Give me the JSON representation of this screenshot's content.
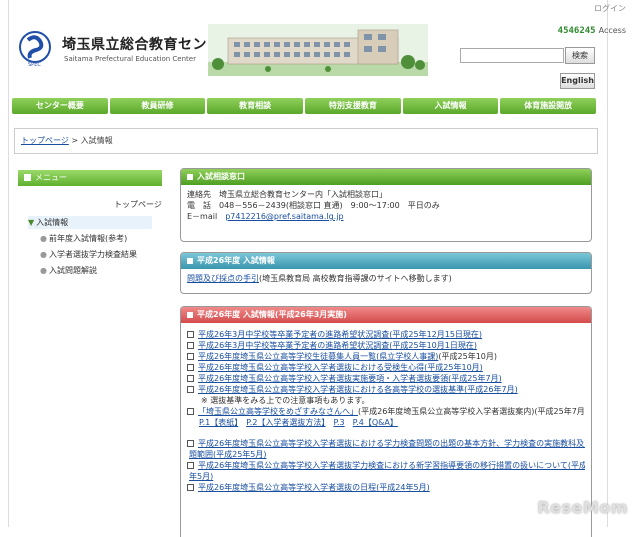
{
  "header": {
    "login_label": "ログイン",
    "site_title": "埼玉県立総合教育センター",
    "site_subtitle": "Saitama Prefectural Education Center",
    "logo_text": "SPEC",
    "counter": "4546245",
    "counter_label": "Access",
    "search_placeholder": "",
    "search_button": "検索",
    "english_button": "English"
  },
  "nav": {
    "items": [
      "センター概要",
      "教員研修",
      "教育相談",
      "特別支援教育",
      "入試情報",
      "体育施設開放"
    ]
  },
  "breadcrumb": {
    "home": "トップページ",
    "sep": " > ",
    "current": "入試情報"
  },
  "sidebar": {
    "menu_title": "メニュー",
    "top_page": "トップページ",
    "active_item": "入試情報",
    "sub_items": [
      "前年度入試情報(参考)",
      "入学者選抜学力検査結果",
      "入試問題解説"
    ]
  },
  "panels": {
    "consult": {
      "title": "入試相談窓口",
      "line1": "連絡先　埼玉県立総合教育センター内「入試相談窓口」",
      "line2": "電　話　048－556－2439(相談窓口 直通)　9:00～17:00　平日のみ",
      "email_label": "E－mail",
      "email": "p7412216@pref.saitama.lg.jp"
    },
    "h26": {
      "title": "平成26年度 入試情報",
      "link": "問題及び採点の手引",
      "rest": "(埼玉県教育局 高校教育指導課のサイトへ移動します)"
    },
    "h26march": {
      "title": "平成26年度 入試情報(平成26年3月実施)",
      "items": [
        "平成26年3月中学校等卒業予定者の進路希望状況調査(平成25年12月15日現在)",
        "平成26年3月中学校等卒業予定者の進路希望状況調査(平成25年10月1日現在)",
        "平成26年度埼玉県公立高等学校生徒募集人員一覧(県立学校人事課)",
        "平成26年度埼玉県公立高等学校入学者選抜における受検生心得(平成25年10月)",
        "平成26年度埼玉県公立高等学校入学者選抜実施要項・入学者選抜要領(平成25年7月)",
        "平成26年度埼玉県公立高等学校入学者選抜における各高等学校の選抜基準(平成26年7月)"
      ],
      "item3_suffix": "(平成25年10月)",
      "note": "※ 選抜基準をみる上での注意事項もあります。",
      "item7_link": "「埼玉県公立高等学校をめざすみなさんへ」",
      "item7_rest": "(平成26年度埼玉県公立高等学校入学者選抜案内)(平成25年7月)",
      "item7_pages": [
        "P.1【表紙】",
        "P.2【入学者選抜方法】",
        "P.3",
        "P.4【Q&A】"
      ],
      "item8_a": "平成26年度埼玉県公立高等学校入学者選抜における学力検査問題の出題の基本方針、学力検査の実施教科及び出",
      "item8_b": "題範囲(平成25年5月)",
      "item9_a": "平成26年度埼玉県公立高等学校入学者選抜学力検査における新学習指導要領の移行措置の扱いについて(平成25",
      "item9_b": "年5月)",
      "item10": "平成26年度埼玉県公立高等学校入学者選抜の日程(平成24年5月)"
    }
  },
  "watermark": "ReseMom"
}
